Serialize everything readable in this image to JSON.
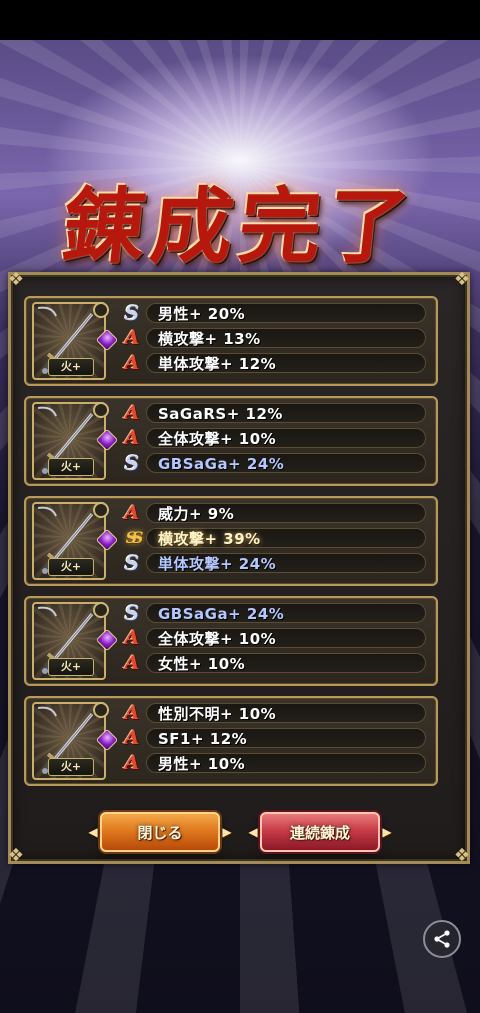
{
  "title": "錬成完了",
  "cards": [
    {
      "rank_label": "火+",
      "rows": [
        {
          "rank": "S",
          "text": "男性+ 20%",
          "style": "white"
        },
        {
          "rank": "A",
          "text": "横攻撃+ 13%",
          "style": "white"
        },
        {
          "rank": "A",
          "text": "単体攻撃+ 12%",
          "style": "white"
        }
      ]
    },
    {
      "rank_label": "火+",
      "rows": [
        {
          "rank": "A",
          "text": "SaGaRS+ 12%",
          "style": "white"
        },
        {
          "rank": "A",
          "text": "全体攻撃+ 10%",
          "style": "white"
        },
        {
          "rank": "S",
          "text": "GBSaGa+ 24%",
          "style": "blue"
        }
      ]
    },
    {
      "rank_label": "火+",
      "rows": [
        {
          "rank": "A",
          "text": "威力+ 9%",
          "style": "white"
        },
        {
          "rank": "SS",
          "text": "横攻撃+ 39%",
          "style": "highlight"
        },
        {
          "rank": "S",
          "text": "単体攻撃+ 24%",
          "style": "blue"
        }
      ]
    },
    {
      "rank_label": "火+",
      "rows": [
        {
          "rank": "S",
          "text": "GBSaGa+ 24%",
          "style": "blue"
        },
        {
          "rank": "A",
          "text": "全体攻撃+ 10%",
          "style": "white"
        },
        {
          "rank": "A",
          "text": "女性+ 10%",
          "style": "white"
        }
      ]
    },
    {
      "rank_label": "火+",
      "rows": [
        {
          "rank": "A",
          "text": "性別不明+ 10%",
          "style": "white"
        },
        {
          "rank": "A",
          "text": "SF1+ 12%",
          "style": "white"
        },
        {
          "rank": "A",
          "text": "男性+ 10%",
          "style": "white"
        }
      ]
    }
  ],
  "buttons": {
    "close_label": "閉じる",
    "continue_label": "連続錬成"
  },
  "icons": {
    "share": "share-icon",
    "weapon": "sword-icon",
    "gem": "purple-gem-icon"
  },
  "colors": {
    "rank_a": "#e04a2e",
    "rank_s": "#c8d4f0",
    "rank_ss": "#f1c24a",
    "blue_text": "#b4c8ff",
    "panel_border": "#a48a55"
  }
}
